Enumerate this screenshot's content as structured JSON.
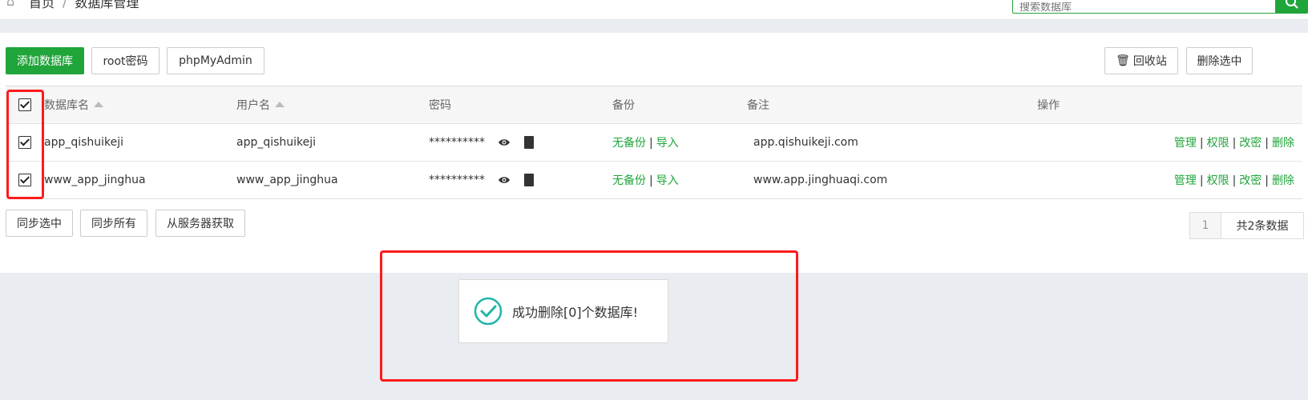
{
  "breadcrumb": {
    "home": "首页",
    "separator": "/",
    "current": "数据库管理"
  },
  "search": {
    "placeholder": "搜索数据库"
  },
  "toolbar": {
    "add_db": "添加数据库",
    "root_password": "root密码",
    "phpmyadmin": "phpMyAdmin",
    "recycle_bin": "回收站",
    "delete_selected": "删除选中"
  },
  "table": {
    "headers": {
      "name": "数据库名",
      "user": "用户名",
      "password": "密码",
      "backup": "备份",
      "note": "备注",
      "ops": "操作"
    },
    "rows": [
      {
        "name": "app_qishuikeji",
        "user": "app_qishuikeji",
        "password": "**********",
        "backup": "无备份",
        "import": "导入",
        "note": "app.qishuikeji.com",
        "manage": "管理",
        "perm": "权限",
        "change_pw": "改密",
        "delete": "删除"
      },
      {
        "name": "www_app_jinghua",
        "user": "www_app_jinghua",
        "password": "**********",
        "backup": "无备份",
        "import": "导入",
        "note": "www.app.jinghuaqi.com",
        "manage": "管理",
        "perm": "权限",
        "change_pw": "改密",
        "delete": "删除"
      }
    ]
  },
  "bottom": {
    "sync_selected": "同步选中",
    "sync_all": "同步所有",
    "fetch_server": "从服务器获取"
  },
  "pager": {
    "current": "1",
    "total": "共2条数据"
  },
  "toast": {
    "message": "成功删除[0]个数据库!"
  },
  "colors": {
    "accent": "#20a53a",
    "annotation": "#ff1a1a",
    "toast_icon": "#1fb6a6"
  },
  "icons": [
    "home-icon",
    "search-icon",
    "trash-icon",
    "eye-icon",
    "copy-icon",
    "check-circle-icon",
    "sort-up-icon"
  ]
}
